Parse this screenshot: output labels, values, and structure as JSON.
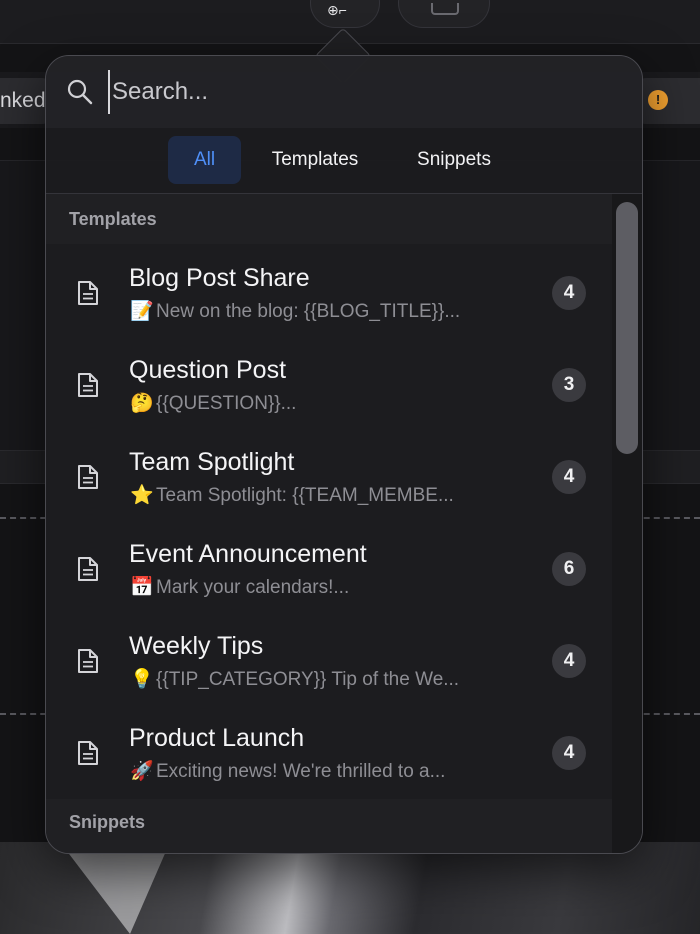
{
  "background": {
    "chip_text": "nked"
  },
  "search": {
    "placeholder": "Search..."
  },
  "tabs": [
    {
      "label": "All",
      "selected": true
    },
    {
      "label": "Templates",
      "selected": false
    },
    {
      "label": "Snippets",
      "selected": false
    }
  ],
  "sections": {
    "templates_header": "Templates",
    "snippets_header": "Snippets"
  },
  "templates": [
    {
      "title": "Blog Post Share",
      "emoji": "📝",
      "preview": "New on the blog: {{BLOG_TITLE}}...",
      "count": "4"
    },
    {
      "title": "Question Post",
      "emoji": "🤔",
      "preview": "{{QUESTION}}...",
      "count": "3"
    },
    {
      "title": "Team Spotlight",
      "emoji": "⭐",
      "preview": "Team Spotlight: {{TEAM_MEMBE...",
      "count": "4"
    },
    {
      "title": "Event Announcement",
      "emoji": "📅",
      "preview": "Mark your calendars!...",
      "count": "6"
    },
    {
      "title": "Weekly Tips",
      "emoji": "💡",
      "preview": "{{TIP_CATEGORY}} Tip of the We...",
      "count": "4"
    },
    {
      "title": "Product Launch",
      "emoji": "🚀",
      "preview": "Exciting news! We're thrilled to a...",
      "count": "4"
    }
  ],
  "colors": {
    "accent": "#4f8ff7",
    "selected_tab_bg": "#1e2a45",
    "warning": "#f0a030"
  },
  "icons": {
    "search": "search-icon",
    "template": "document-icon",
    "warning": "warning-icon"
  }
}
